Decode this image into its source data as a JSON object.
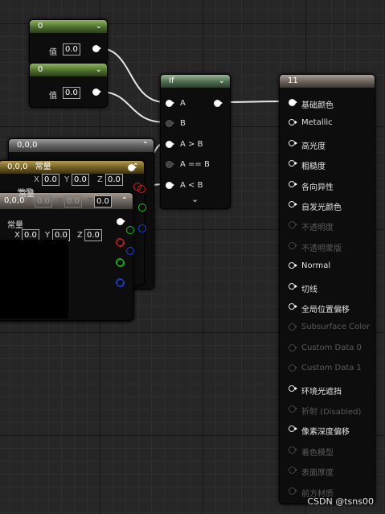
{
  "const1": {
    "title": "0",
    "label": "值",
    "value": "0.0"
  },
  "const2": {
    "title": "0",
    "label": "值",
    "value": "0.0"
  },
  "if_node": {
    "title": "If",
    "inputs": [
      "A",
      "B",
      "A > B",
      "A == B",
      "A < B"
    ],
    "expand": "⌄"
  },
  "vec_nodes": [
    {
      "title": "0,0,0"
    },
    {
      "title": "0,0,0",
      "subtitle": "常量",
      "label": "常量",
      "x_label": "X",
      "y_label": "Y",
      "z_label": "Z",
      "x": "0.0",
      "y": "0.0",
      "z": "0.0"
    },
    {
      "title": "0,0,0",
      "label": "常量",
      "x_label": "X",
      "y_label": "Y",
      "z_label": "Z",
      "x": "0.0",
      "y": "0.0",
      "z": "0.0"
    },
    {
      "label": "常量",
      "x_label": "X",
      "y_label": "Y",
      "z_label": "Z",
      "x": "0.0",
      "y": "0.0",
      "z": "0.0"
    }
  ],
  "material": {
    "title": "11",
    "inputs": [
      {
        "label": "基础颜色",
        "state": "connected"
      },
      {
        "label": "Metallic",
        "state": "enabled"
      },
      {
        "label": "高光度",
        "state": "enabled"
      },
      {
        "label": "粗糙度",
        "state": "enabled"
      },
      {
        "label": "各向异性",
        "state": "enabled"
      },
      {
        "label": "自发光颜色",
        "state": "enabled"
      },
      {
        "label": "不透明度",
        "state": "disabled"
      },
      {
        "label": "不透明蒙版",
        "state": "disabled"
      },
      {
        "label": "Normal",
        "state": "enabled"
      },
      {
        "label": "切线",
        "state": "enabled"
      },
      {
        "label": "全局位置偏移",
        "state": "enabled"
      },
      {
        "label": "Subsurface Color",
        "state": "disabled"
      },
      {
        "label": "Custom Data 0",
        "state": "disabled"
      },
      {
        "label": "Custom Data 1",
        "state": "disabled"
      },
      {
        "label": "环境光遮挡",
        "state": "enabled"
      },
      {
        "label": "折射 (Disabled)",
        "state": "disabled"
      },
      {
        "label": "像素深度偏移",
        "state": "enabled"
      },
      {
        "label": "着色模型",
        "state": "disabled"
      },
      {
        "label": "表面厚度",
        "state": "disabled"
      },
      {
        "label": "前方材质",
        "state": "disabled"
      }
    ]
  },
  "watermark": "CSDN @tsns00",
  "colors": {
    "green_header": "#4d6e2d",
    "gold_header": "#6e5b21",
    "red_pin": "#d02020",
    "green_pin": "#20c020",
    "blue_pin": "#2040e0"
  }
}
